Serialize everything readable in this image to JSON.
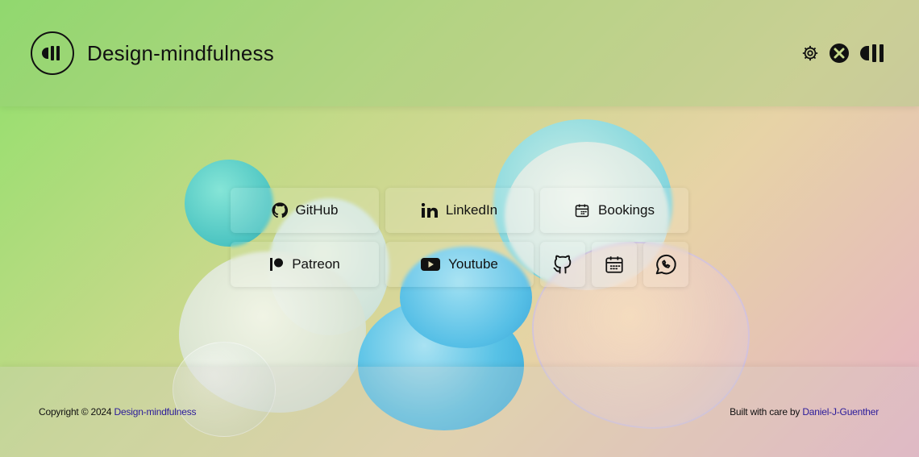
{
  "header": {
    "title": "Design-mindfulness",
    "logo_text": "dll",
    "icons": [
      "settings-icon",
      "x-close-icon",
      "dm-logo-icon"
    ]
  },
  "links": {
    "github": "GitHub",
    "linkedin": "LinkedIn",
    "bookings": "Bookings",
    "patreon": "Patreon",
    "youtube": "Youtube",
    "icon_only": [
      "github-icon",
      "calendar-icon",
      "whatsapp-icon"
    ]
  },
  "footer": {
    "copyright_prefix": "Copyright © 2024",
    "copyright_link": "Design-mindfulness",
    "built_prefix": "Built with care by",
    "built_link": "Daniel-J-Guenther"
  },
  "colors": {
    "gradient_start": "#8fe06a",
    "gradient_end": "#e5b2c4",
    "footer_link": "#2a1a9a"
  }
}
